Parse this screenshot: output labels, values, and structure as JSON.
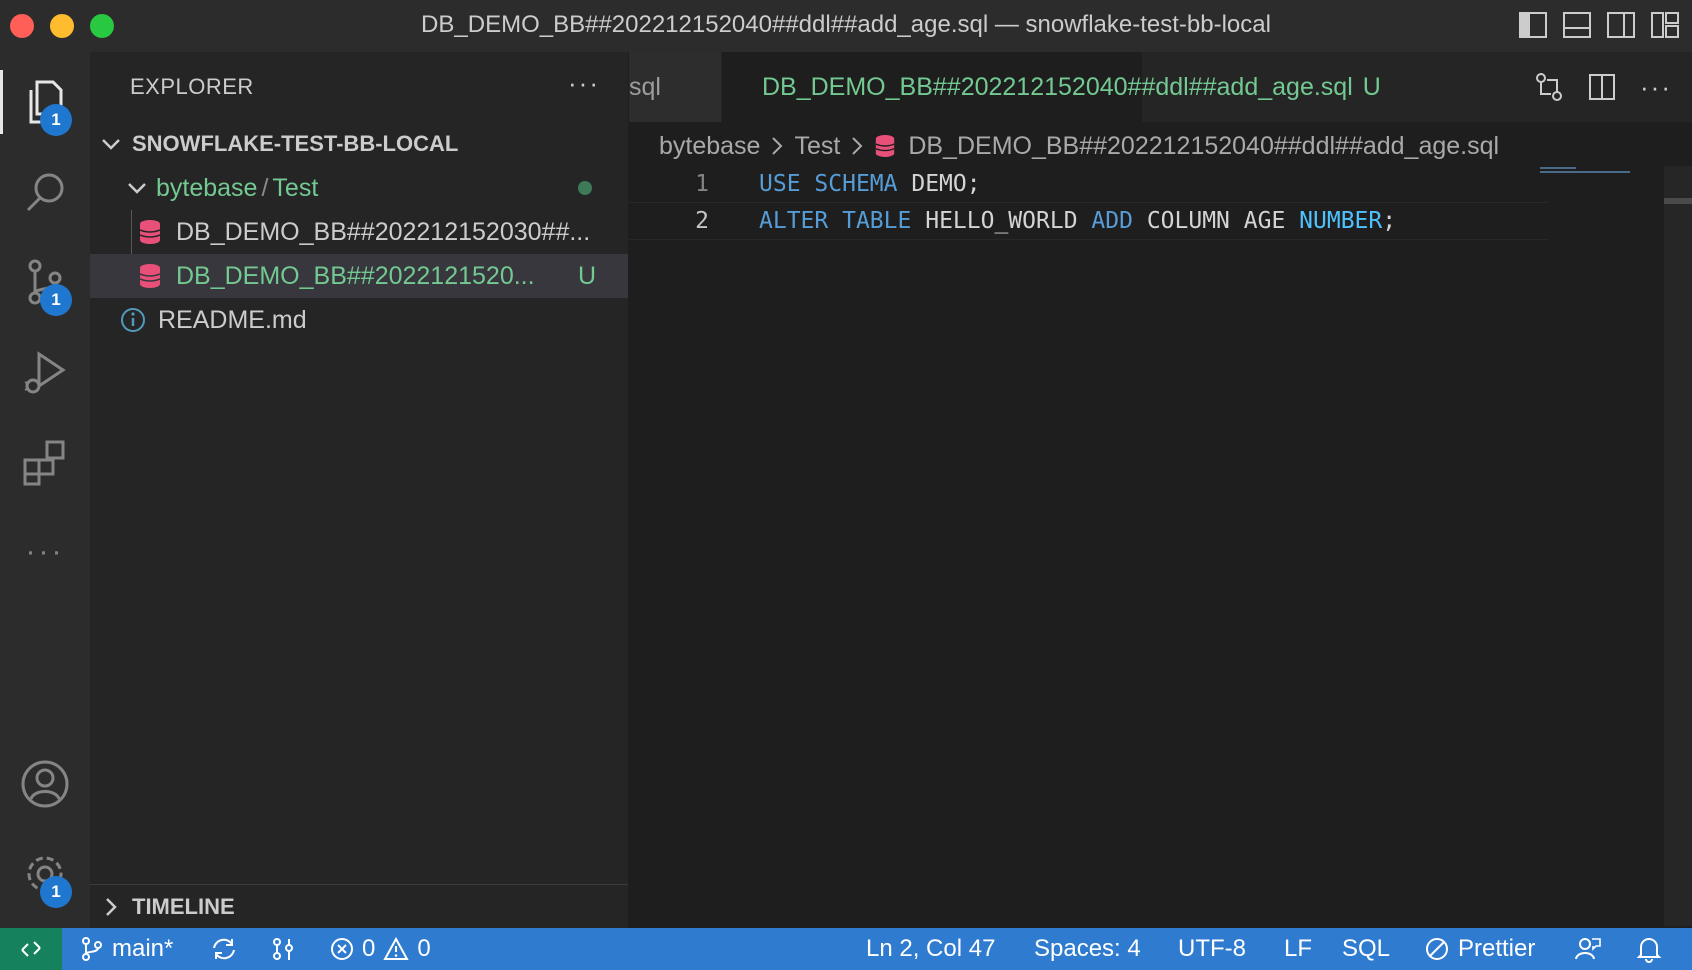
{
  "window": {
    "title": "DB_DEMO_BB##202212152040##ddl##add_age.sql — snowflake-test-bb-local"
  },
  "activity_bar": {
    "explorer_badge": "1",
    "source_control_badge": "1",
    "settings_badge": "1"
  },
  "sidebar": {
    "title": "EXPLORER",
    "more": "···",
    "workspace": "SNOWFLAKE-TEST-BB-LOCAL",
    "folder": {
      "part1": "bytebase",
      "sep": "/",
      "part2": "Test"
    },
    "files": [
      {
        "name": "DB_DEMO_BB##202212152030##...",
        "status": ""
      },
      {
        "name": "DB_DEMO_BB##2022121520...",
        "status": "U"
      }
    ],
    "readme": "README.md",
    "timeline": "TIMELINE"
  },
  "editor": {
    "inactive_tab": "sql",
    "active_tab": {
      "name": "DB_DEMO_BB##202212152040##ddl##add_age.sql",
      "status": "U"
    },
    "breadcrumb": [
      "bytebase",
      "Test",
      "DB_DEMO_BB##202212152040##ddl##add_age.sql"
    ],
    "lines": [
      {
        "num": "1",
        "tokens": [
          "USE",
          "SCHEMA",
          "DEMO;"
        ]
      },
      {
        "num": "2",
        "tokens": [
          "ALTER",
          "TABLE",
          "HELLO_WORLD",
          "ADD",
          "COLUMN",
          "AGE",
          "NUMBER",
          ";"
        ]
      }
    ]
  },
  "status_bar": {
    "branch": "main*",
    "errors": "0",
    "warnings": "0",
    "cursor": "Ln 2, Col 47",
    "spaces": "Spaces: 4",
    "encoding": "UTF-8",
    "eol": "LF",
    "language": "SQL",
    "formatter": "Prettier"
  },
  "colors": {
    "accent_blue": "#2f7bd0",
    "untracked_green": "#73c991",
    "sql_icon_pink": "#e8507a",
    "keyword_blue": "#569cd6"
  }
}
